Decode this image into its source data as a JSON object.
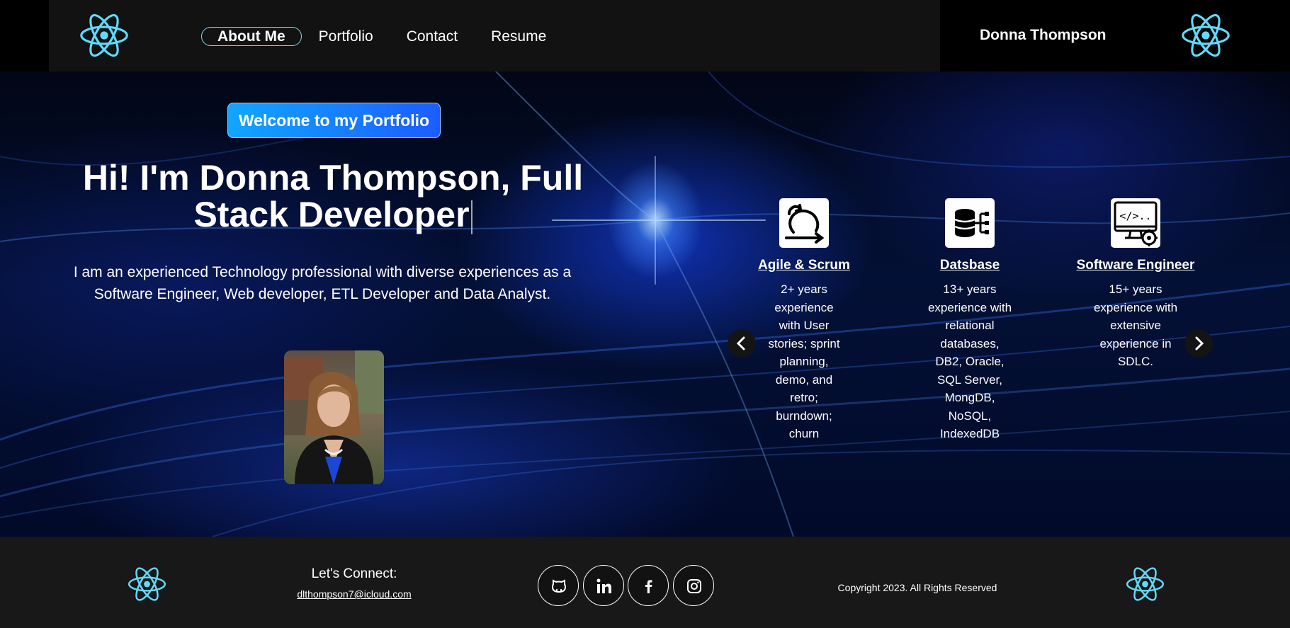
{
  "header": {
    "nav": [
      {
        "label": "About Me",
        "active": true
      },
      {
        "label": "Portfolio",
        "active": false
      },
      {
        "label": "Contact",
        "active": false
      },
      {
        "label": "Resume",
        "active": false
      }
    ],
    "brand_name": "Donna Thompson",
    "logo_icon": "react-atom-icon"
  },
  "hero": {
    "welcome_button": "Welcome to my Portfolio",
    "title_line1": "Hi! I'm Donna Thompson, Full",
    "title_line2": "Stack Developer",
    "description": "I am an experienced Technology professional with diverse experiences as a Software Engineer, Web developer, ETL Developer and Data Analyst.",
    "portrait_icon": "profile-photo"
  },
  "skills": {
    "prev_icon": "chevron-left-icon",
    "next_icon": "chevron-right-icon",
    "items": [
      {
        "title": "Agile & Scrum",
        "icon": "agile-cycle-icon",
        "description": "2+ years experience with User stories; sprint planning, demo, and retro; burndown; churn"
      },
      {
        "title": "Datsbase",
        "icon": "database-icon",
        "description": "13+ years experience with relational databases, DB2, Oracle, SQL Server, MongDB, NoSQL, IndexedDB"
      },
      {
        "title": "Software Engineer",
        "icon": "code-settings-icon",
        "description": "15+ years experience with extensive experience in SDLC."
      }
    ]
  },
  "footer": {
    "connect_label": "Let's Connect:",
    "email": "dlthompson7@icloud.com",
    "social_icons": [
      "github-icon",
      "linkedin-icon",
      "facebook-icon",
      "instagram-icon"
    ],
    "copyright": "Copyright 2023. All Rights Reserved"
  },
  "colors": {
    "nav_bg": "#121212",
    "accent_cyan": "#61dafb",
    "welcome_gradient_start": "#12a6ff",
    "welcome_gradient_end": "#1c5cff",
    "footer_bg": "#181818"
  }
}
